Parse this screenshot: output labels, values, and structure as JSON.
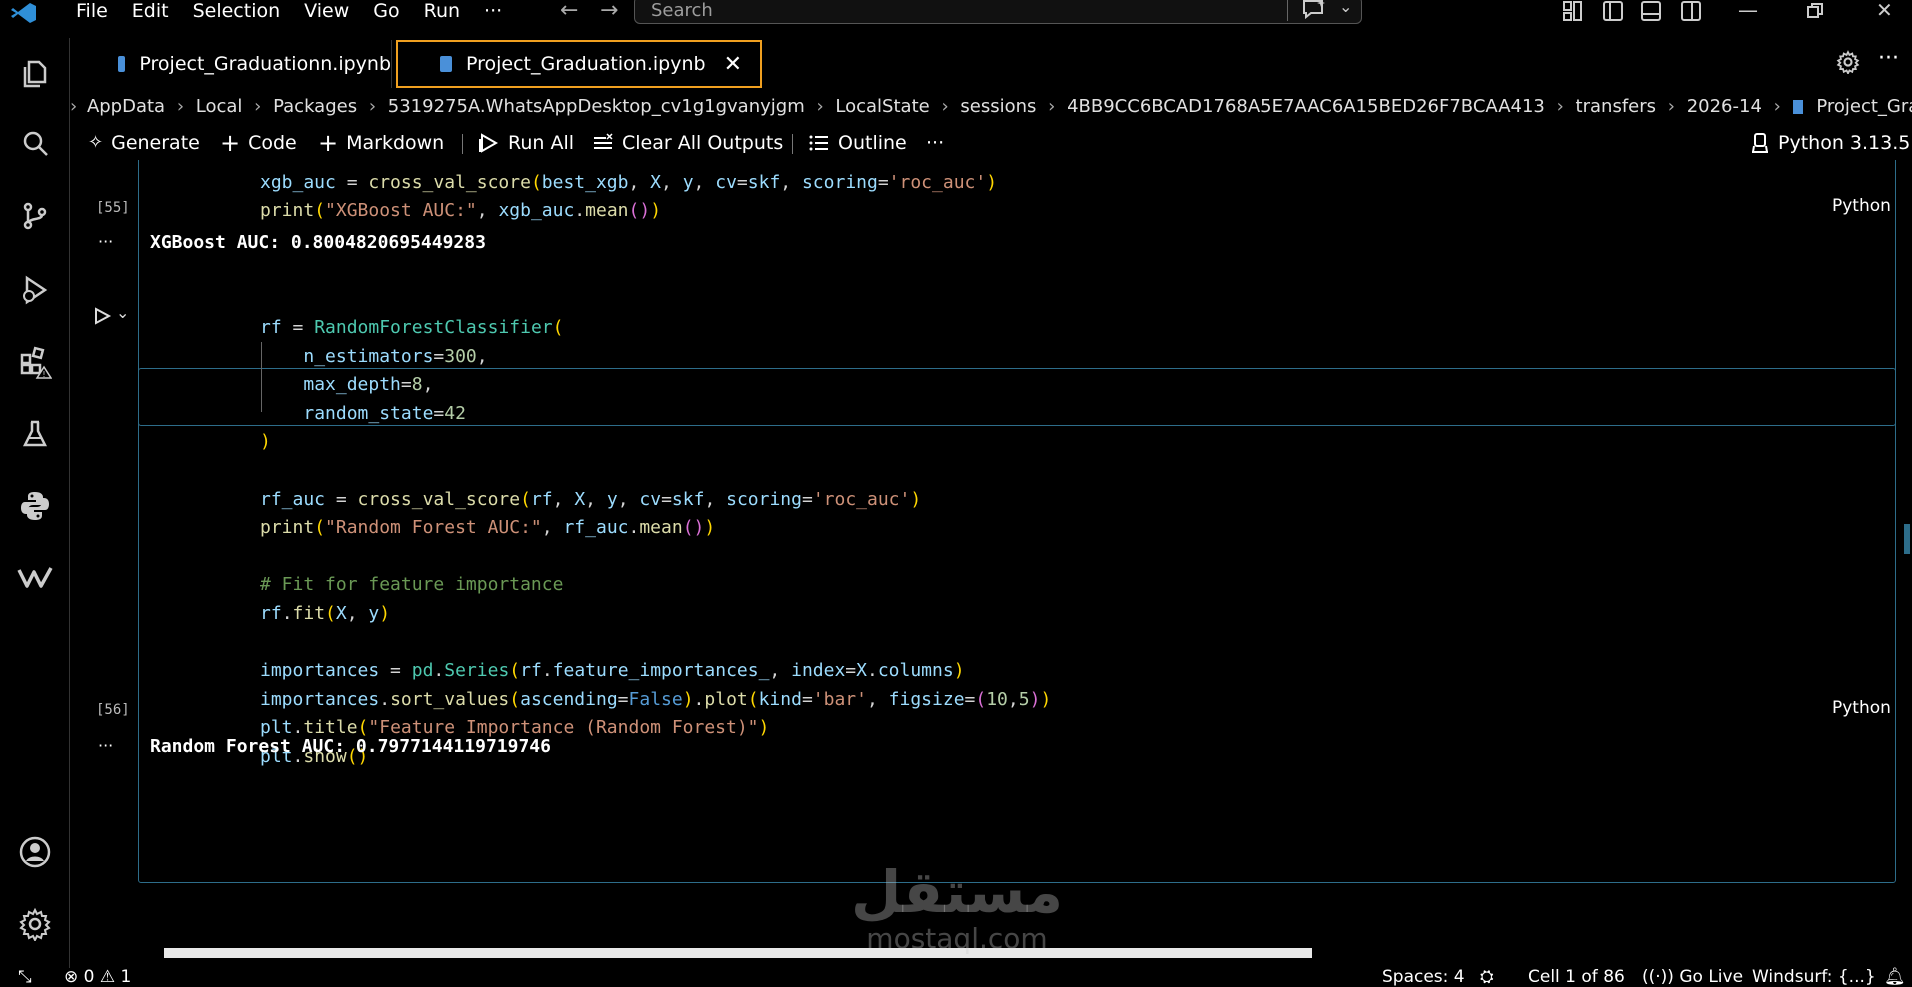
{
  "menu": [
    "File",
    "Edit",
    "Selection",
    "View",
    "Go",
    "Run",
    "···"
  ],
  "search": {
    "placeholder": "Search"
  },
  "tabs": [
    {
      "label": "Project_Graduationn.ipynb",
      "active": false
    },
    {
      "label": "Project_Graduation.ipynb",
      "active": true,
      "close": "✕"
    }
  ],
  "breadcrumb": [
    "AppData",
    "Local",
    "Packages",
    "5319275A.WhatsAppDesktop_cv1g1gvanyjgm",
    "LocalState",
    "sessions",
    "4BB9CC6BCAD1768A5E7AAC6A15BED26F7BCAA413",
    "transfers",
    "2026-14",
    "Project_Graduation.ipynb"
  ],
  "toolbar": {
    "generate": "Generate",
    "code": "Code",
    "markdown": "Markdown",
    "run_all": "Run All",
    "clear_outputs": "Clear All Outputs",
    "outline": "Outline",
    "more": "···",
    "kernel": "Python 3.13.5"
  },
  "cells": [
    {
      "exec": "[55]",
      "lang": "Python",
      "output": "XGBoost AUC: 0.8004820695449283"
    },
    {
      "exec": "[56]",
      "lang": "Python",
      "output": "Random Forest AUC: 0.7977144119719746"
    }
  ],
  "output_dots": "···",
  "statusbar": {
    "errors": "0",
    "warnings": "1",
    "spaces": "Spaces: 4",
    "cell": "Cell 1 of 86",
    "go_live": "Go Live",
    "windsurf": "Windsurf: {...}"
  },
  "watermark": {
    "arabic": "مستقل",
    "latin": "mostaql.com"
  },
  "colors": {
    "accent": "#2d6d8a",
    "active_tab_border": "#f0a020"
  }
}
